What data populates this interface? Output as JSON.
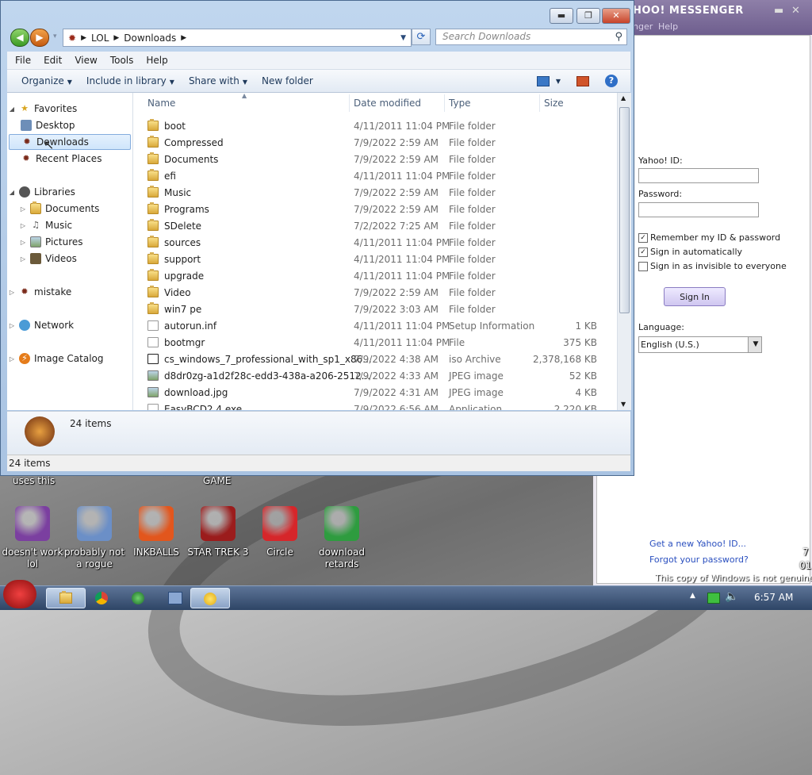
{
  "messenger": {
    "title": "HOO! MESSENGER",
    "menu": [
      "nger",
      "Help"
    ],
    "yahoo_id_label": "Yahoo! ID:",
    "password_label": "Password:",
    "remember_label": "Remember my ID & password",
    "auto_label": "Sign in automatically",
    "invisible_label": "Sign in as invisible to everyone",
    "sign_in_button": "Sign In",
    "language_label": "Language:",
    "language_value": "English (U.S.)",
    "get_id_link": "Get a new Yahoo! ID...",
    "forgot_link": "Forgot your password?"
  },
  "explorer": {
    "address": [
      "LOL",
      "Downloads"
    ],
    "search_placeholder": "Search Downloads",
    "menu": [
      "File",
      "Edit",
      "View",
      "Tools",
      "Help"
    ],
    "toolbar": {
      "organize": "Organize",
      "include": "Include in library",
      "share": "Share with",
      "new_folder": "New folder"
    },
    "nav": {
      "favorites": "Favorites",
      "desktop": "Desktop",
      "downloads": "Downloads",
      "recent": "Recent Places",
      "libraries": "Libraries",
      "documents": "Documents",
      "music": "Music",
      "pictures": "Pictures",
      "videos": "Videos",
      "mistake": "mistake",
      "network": "Network",
      "image_catalog": "Image Catalog"
    },
    "columns": {
      "name": "Name",
      "date": "Date modified",
      "type": "Type",
      "size": "Size"
    },
    "files": [
      {
        "name": "boot",
        "date": "4/11/2011 11:04 PM",
        "type": "File folder",
        "size": "",
        "kind": "folder"
      },
      {
        "name": "Compressed",
        "date": "7/9/2022 2:59 AM",
        "type": "File folder",
        "size": "",
        "kind": "folder"
      },
      {
        "name": "Documents",
        "date": "7/9/2022 2:59 AM",
        "type": "File folder",
        "size": "",
        "kind": "folder"
      },
      {
        "name": "efi",
        "date": "4/11/2011 11:04 PM",
        "type": "File folder",
        "size": "",
        "kind": "folder"
      },
      {
        "name": "Music",
        "date": "7/9/2022 2:59 AM",
        "type": "File folder",
        "size": "",
        "kind": "folder"
      },
      {
        "name": "Programs",
        "date": "7/9/2022 2:59 AM",
        "type": "File folder",
        "size": "",
        "kind": "folder"
      },
      {
        "name": "SDelete",
        "date": "7/2/2022 7:25 AM",
        "type": "File folder",
        "size": "",
        "kind": "folder"
      },
      {
        "name": "sources",
        "date": "4/11/2011 11:04 PM",
        "type": "File folder",
        "size": "",
        "kind": "folder"
      },
      {
        "name": "support",
        "date": "4/11/2011 11:04 PM",
        "type": "File folder",
        "size": "",
        "kind": "folder"
      },
      {
        "name": "upgrade",
        "date": "4/11/2011 11:04 PM",
        "type": "File folder",
        "size": "",
        "kind": "folder"
      },
      {
        "name": "Video",
        "date": "7/9/2022 2:59 AM",
        "type": "File folder",
        "size": "",
        "kind": "folder"
      },
      {
        "name": "win7 pe",
        "date": "7/9/2022 3:03 AM",
        "type": "File folder",
        "size": "",
        "kind": "folder"
      },
      {
        "name": "autorun.inf",
        "date": "4/11/2011 11:04 PM",
        "type": "Setup Information",
        "size": "1 KB",
        "kind": "doc"
      },
      {
        "name": "bootmgr",
        "date": "4/11/2011 11:04 PM",
        "type": "File",
        "size": "375 KB",
        "kind": "doc"
      },
      {
        "name": "cs_windows_7_professional_with_sp1_x86...",
        "date": "7/9/2022 4:38 AM",
        "type": "iso Archive",
        "size": "2,378,168 KB",
        "kind": "iso"
      },
      {
        "name": "d8dr0zg-a1d2f28c-edd3-438a-a206-2512...",
        "date": "7/9/2022 4:33 AM",
        "type": "JPEG image",
        "size": "52 KB",
        "kind": "img"
      },
      {
        "name": "download.jpg",
        "date": "7/9/2022 4:31 AM",
        "type": "JPEG image",
        "size": "4 KB",
        "kind": "img"
      },
      {
        "name": "EasyBCD2.4.exe",
        "date": "7/9/2022 6:56 AM",
        "type": "Application",
        "size": "2,220 KB",
        "kind": "doc"
      }
    ],
    "details_count": "24 items",
    "status_count": "24 items"
  },
  "desktop": {
    "top_labels": [
      "uses this",
      "GAME"
    ],
    "icons": [
      {
        "label": "doesn't work lol",
        "color": "#7b3fa0"
      },
      {
        "label": "probably not a rogue",
        "color": "#6b8fc7"
      },
      {
        "label": "INKBALLS",
        "color": "#e2561d"
      },
      {
        "label": "STAR TREK 3",
        "color": "#9b1c1c"
      },
      {
        "label": "Circle",
        "color": "#d6262a"
      },
      {
        "label": "download retards",
        "color": "#2e9c3f"
      }
    ],
    "watermark": "This copy of Windows is not genuine",
    "side_digits": [
      "7",
      "01"
    ]
  },
  "taskbar": {
    "time": "6:57 AM"
  },
  "colors": {
    "accent": "#3b6ea5",
    "ym_purple": "#6e5e8e"
  }
}
